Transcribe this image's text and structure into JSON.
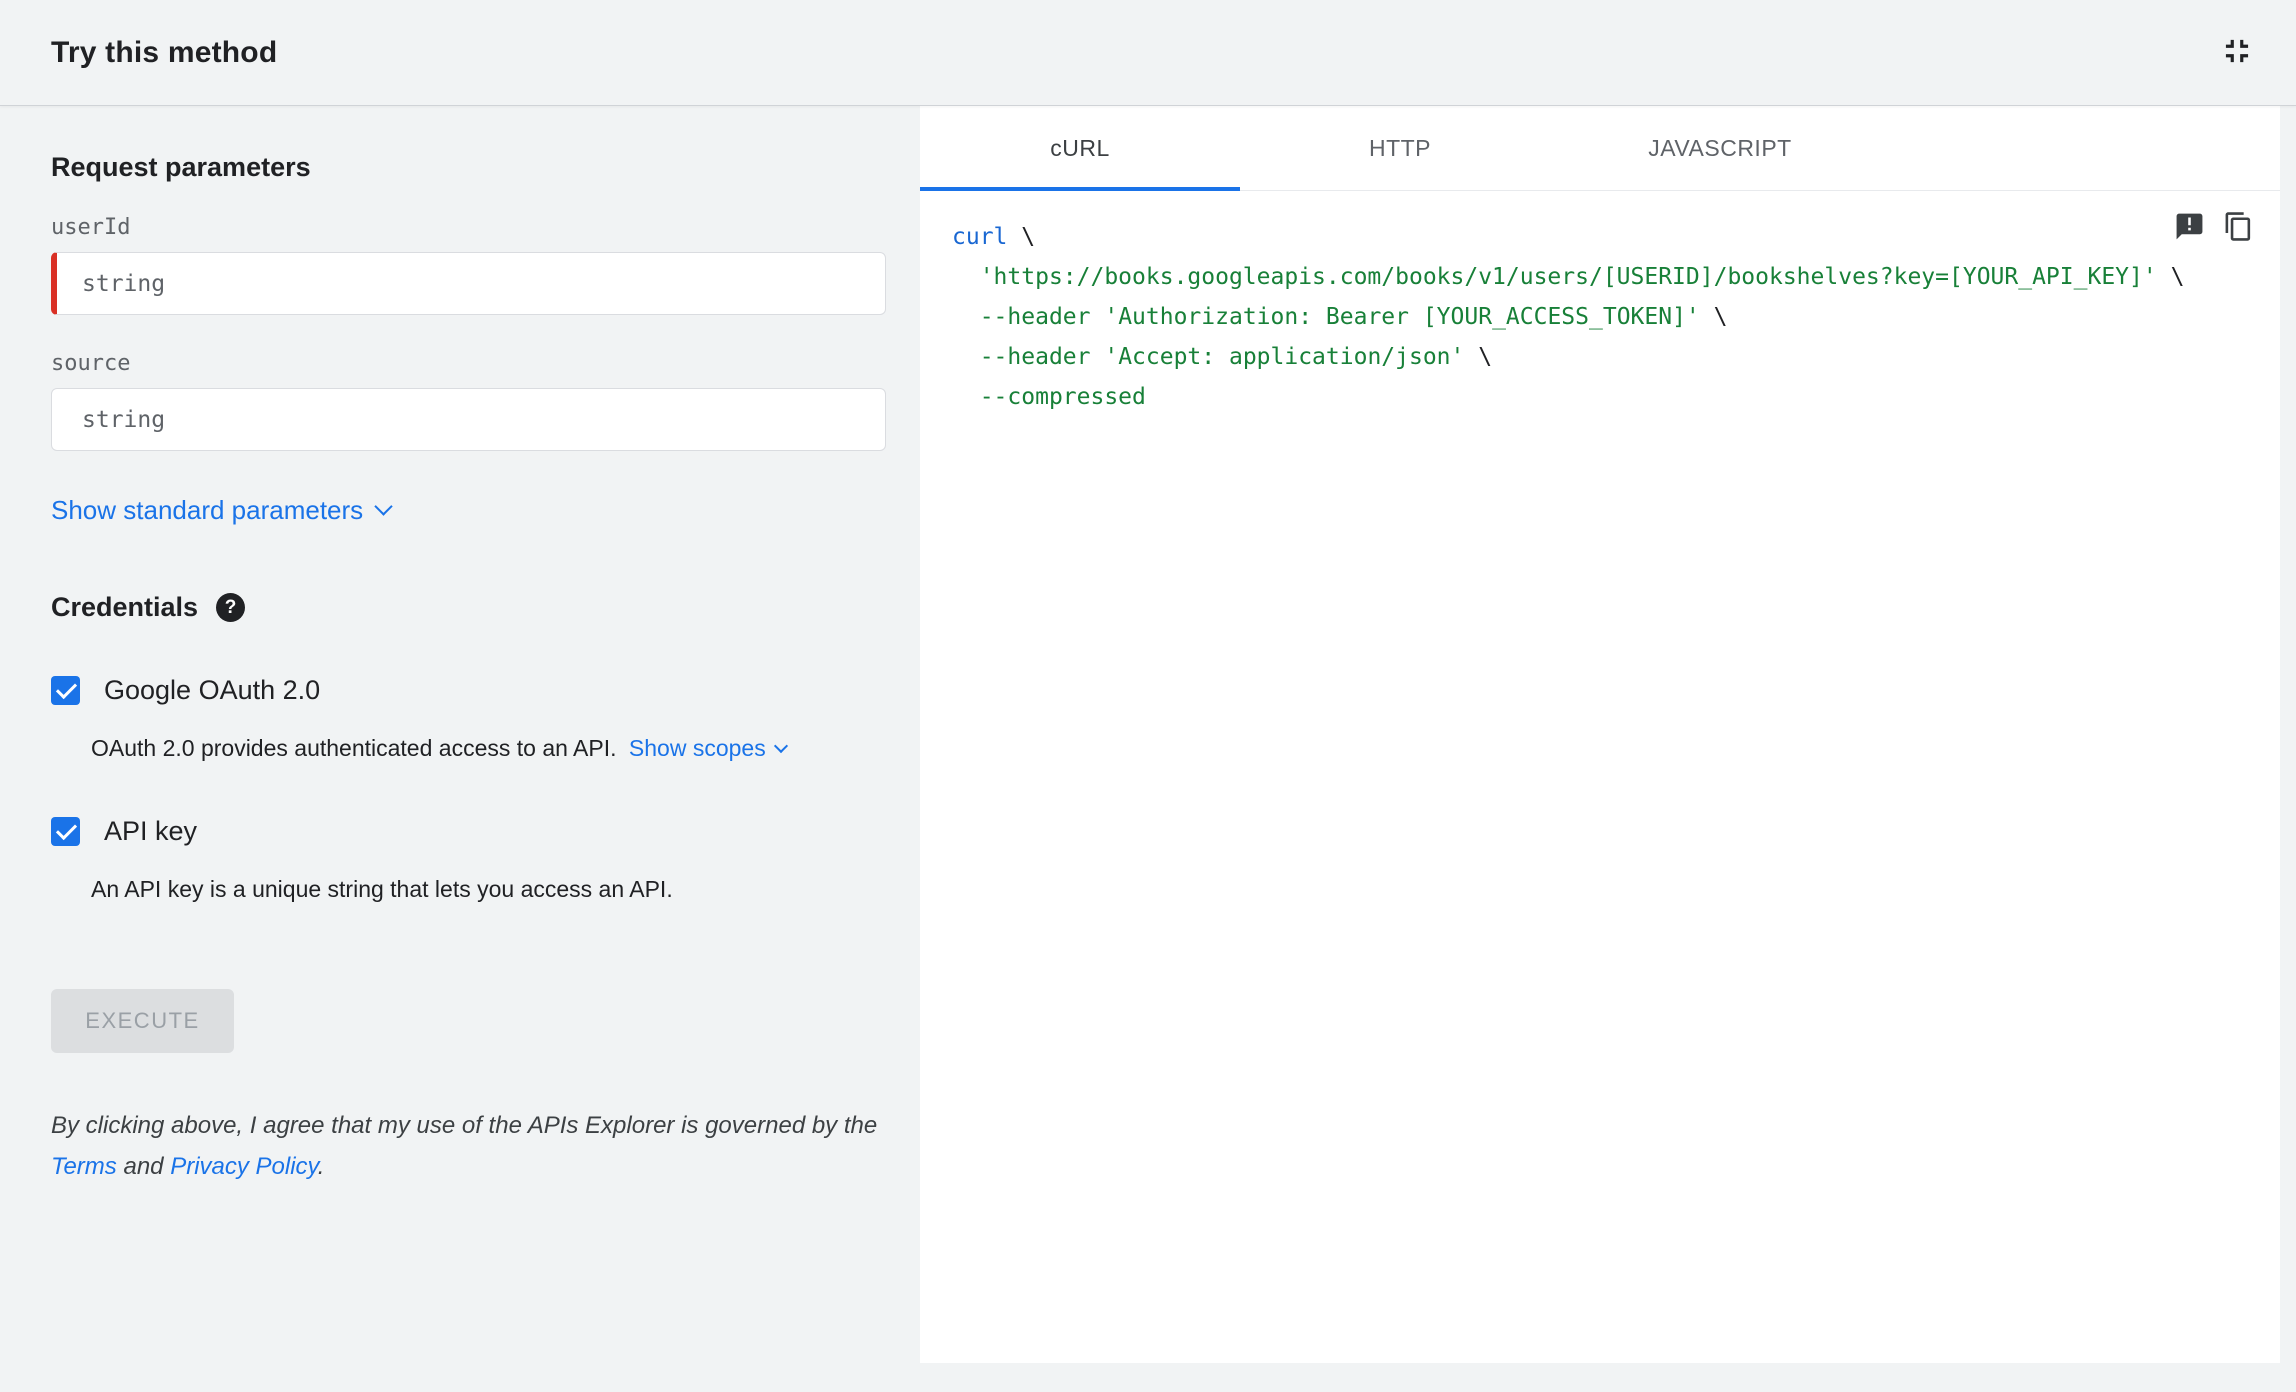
{
  "header": {
    "title": "Try this method"
  },
  "request": {
    "section_title": "Request parameters",
    "fields": [
      {
        "label": "userId",
        "placeholder": "string",
        "required": true
      },
      {
        "label": "source",
        "placeholder": "string",
        "required": false
      }
    ],
    "show_standard_parameters": "Show standard parameters"
  },
  "credentials": {
    "section_title": "Credentials",
    "help_glyph": "?",
    "options": [
      {
        "label": "Google OAuth 2.0",
        "checked": true,
        "description": "OAuth 2.0 provides authenticated access to an API.",
        "link_label": "Show scopes"
      },
      {
        "label": "API key",
        "checked": true,
        "description": "An API key is a unique string that lets you access an API."
      }
    ]
  },
  "execute_label": "EXECUTE",
  "disclaimer": {
    "text_before": "By clicking above, I agree that my use of the APIs Explorer is governed by the ",
    "terms_label": "Terms",
    "text_middle": " and ",
    "privacy_label": "Privacy Policy",
    "text_after": "."
  },
  "tabs": [
    {
      "label": "cURL",
      "active": true
    },
    {
      "label": "HTTP",
      "active": false
    },
    {
      "label": "JAVASCRIPT",
      "active": false
    }
  ],
  "code": {
    "language": "curl",
    "lines": [
      {
        "tokens": [
          {
            "text": "curl",
            "type": "keyword"
          },
          {
            "text": " \\",
            "type": "plain"
          }
        ]
      },
      {
        "tokens": [
          {
            "text": "  ",
            "type": "plain"
          },
          {
            "text": "'https://books.googleapis.com/books/v1/users/[USERID]/bookshelves?key=[YOUR_API_KEY]'",
            "type": "string"
          },
          {
            "text": " \\",
            "type": "plain"
          }
        ]
      },
      {
        "tokens": [
          {
            "text": "  ",
            "type": "plain"
          },
          {
            "text": "--header",
            "type": "flag"
          },
          {
            "text": " ",
            "type": "plain"
          },
          {
            "text": "'Authorization: Bearer [YOUR_ACCESS_TOKEN]'",
            "type": "string"
          },
          {
            "text": " \\",
            "type": "plain"
          }
        ]
      },
      {
        "tokens": [
          {
            "text": "  ",
            "type": "plain"
          },
          {
            "text": "--header",
            "type": "flag"
          },
          {
            "text": " ",
            "type": "plain"
          },
          {
            "text": "'Accept: application/json'",
            "type": "string"
          },
          {
            "text": " \\",
            "type": "plain"
          }
        ]
      },
      {
        "tokens": [
          {
            "text": "  ",
            "type": "plain"
          },
          {
            "text": "--compressed",
            "type": "flag"
          }
        ]
      }
    ]
  },
  "colors": {
    "accent_blue": "#1a73e8",
    "required_red": "#d93025",
    "code_keyword": "#1967d2",
    "code_string": "#188038",
    "panel_gray": "#f1f3f4"
  }
}
